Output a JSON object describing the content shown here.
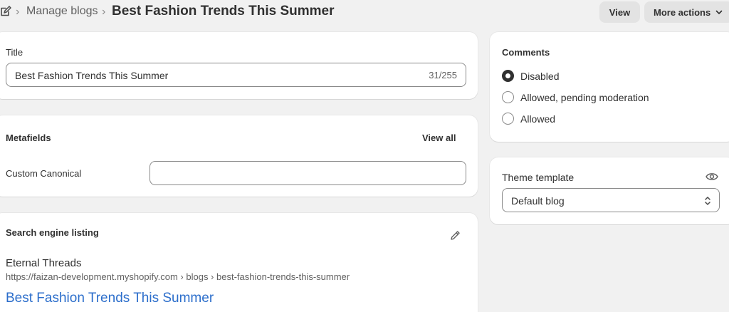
{
  "breadcrumb": {
    "separator": "›",
    "parent": "Manage blogs",
    "current": "Best Fashion Trends This Summer"
  },
  "header_actions": {
    "view_label": "View",
    "more_actions_label": "More actions"
  },
  "title_card": {
    "label": "Title",
    "value": "Best Fashion Trends This Summer",
    "char_count": "31/255"
  },
  "metafields": {
    "heading": "Metafields",
    "view_all_label": "View all",
    "field_label": "Custom Canonical",
    "field_value": ""
  },
  "seo": {
    "heading": "Search engine listing",
    "store_name": "Eternal Threads",
    "url": "https://faizan-development.myshopify.com › blogs › best-fashion-trends-this-summer",
    "title": "Best Fashion Trends This Summer"
  },
  "comments": {
    "heading": "Comments",
    "options": [
      {
        "label": "Disabled",
        "checked": true
      },
      {
        "label": "Allowed, pending moderation",
        "checked": false
      },
      {
        "label": "Allowed",
        "checked": false
      }
    ]
  },
  "theme_template": {
    "label": "Theme template",
    "selected": "Default blog"
  },
  "colors": {
    "link": "#2c6ecb",
    "background": "#f1f1f1",
    "card": "#ffffff"
  }
}
